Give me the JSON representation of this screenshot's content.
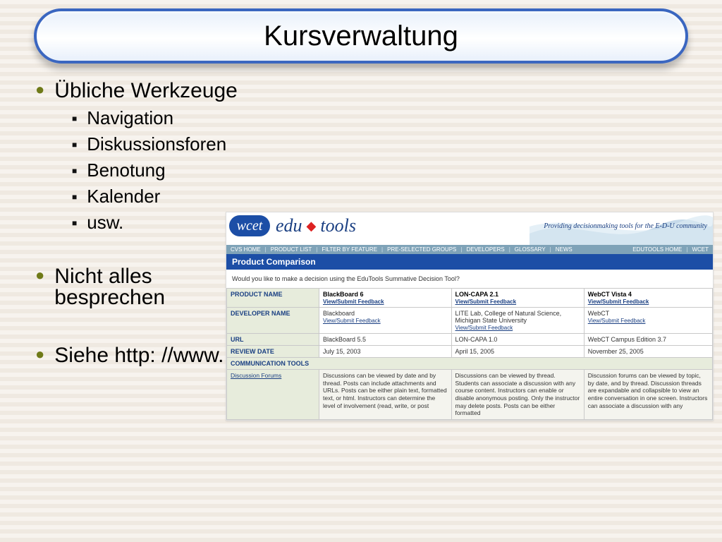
{
  "title": "Kursverwaltung",
  "bullets": {
    "werkzeuge_label": "Übliche Werkzeuge",
    "items": [
      "Navigation",
      "Diskussionsforen",
      "Benotung",
      "Kalender",
      "usw."
    ],
    "nicht_alles_l1": "Nicht alles",
    "nicht_alles_l2": "besprechen",
    "siehe": "Siehe http: //www. edutools. info/"
  },
  "screenshot": {
    "logo": {
      "wcet": "wcet",
      "edu": "edu",
      "tools": "tools"
    },
    "tagline": "Providing decisionmaking tools for the E-D-U community",
    "nav": [
      "CVS HOME",
      "PRODUCT LIST",
      "FILTER BY FEATURE",
      "PRE-SELECTED GROUPS",
      "DEVELOPERS",
      "GLOSSARY",
      "NEWS",
      "EDUTOOLS HOME",
      "WCET"
    ],
    "bar": "Product Comparison",
    "question": "Would you like to make a decision using the EduTools Summative Decision Tool?",
    "feedback_label": "View/Submit Feedback",
    "rows": {
      "product_name": "PRODUCT NAME",
      "developer_name": "DEVELOPER NAME",
      "url": "URL",
      "review_date": "REVIEW DATE",
      "comm_tools": "COMMUNICATION TOOLS",
      "discussion_forums": "Discussion Forums"
    },
    "products": [
      {
        "name": "BlackBoard 6",
        "developer": "Blackboard",
        "url": "BlackBoard 5.5",
        "review_date": "July 15, 2003",
        "discussion": "Discussions can be viewed by date and by thread. Posts can include attachments and URLs. Posts can be either plain text, formatted text, or html. Instructors can determine the level of involvement (read, write, or post"
      },
      {
        "name": "LON-CAPA 2.1",
        "developer": "LITE Lab, College of Natural Science, Michigan State University",
        "url": "LON-CAPA 1.0",
        "review_date": "April 15, 2005",
        "discussion": "Discussions can be viewed by thread. Students can associate a discussion with any course content. Instructors can enable or disable anonymous posting. Only the instructor may delete posts. Posts can be either formatted"
      },
      {
        "name": "WebCT Vista 4",
        "developer": "WebCT",
        "url": "WebCT Campus Edition 3.7",
        "review_date": "November 25, 2005",
        "discussion": "Discussion forums can be viewed by topic, by date, and by thread. Discussion threads are expandable and collapsible to view an entire conversation in one screen. Instructors can associate a discussion with any"
      }
    ]
  }
}
